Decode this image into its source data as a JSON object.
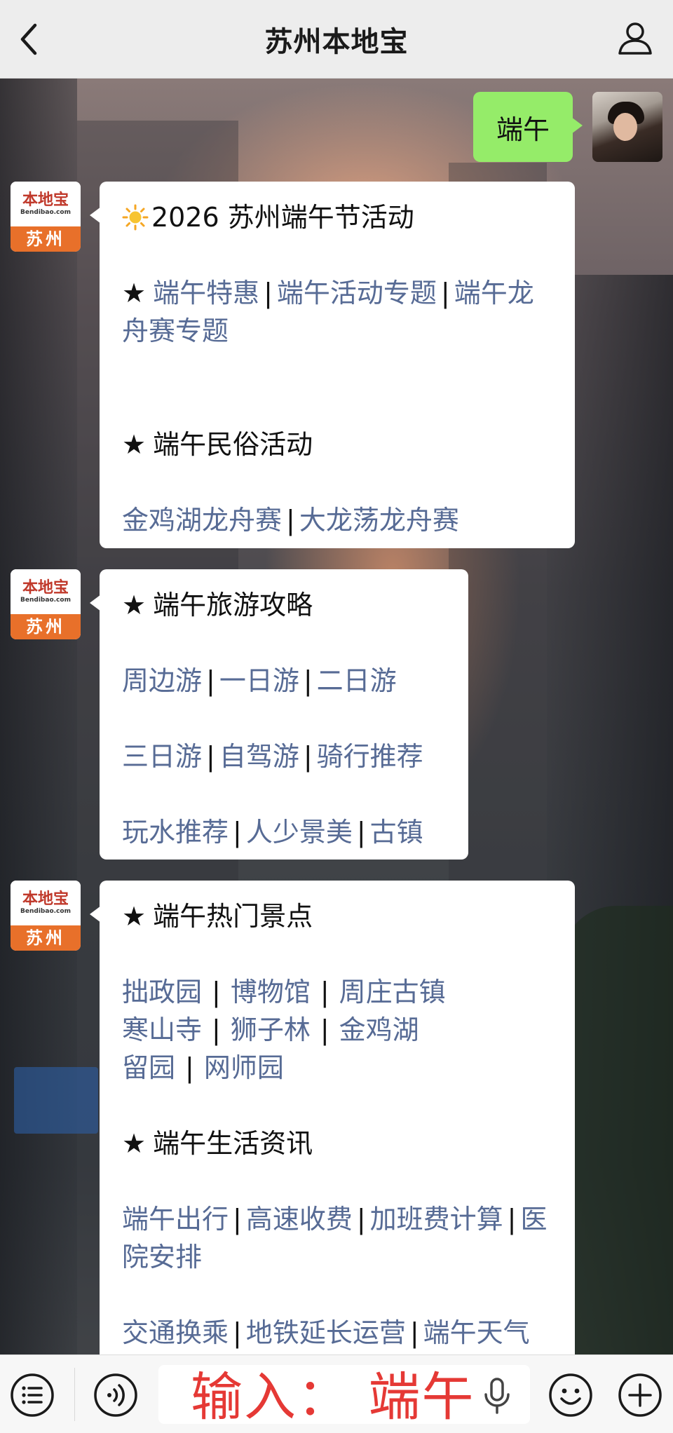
{
  "header": {
    "title": "苏州本地宝"
  },
  "user_message": {
    "text": "端午"
  },
  "bot": {
    "avatar_top": "本地宝",
    "avatar_url": "Bendibao.com",
    "avatar_city": "苏州"
  },
  "msg1": {
    "title": "2026 苏州端午节活动",
    "links1": [
      "端午特惠",
      "端午活动专题",
      "端午龙舟赛专题"
    ],
    "section_folk": "端午民俗活动",
    "links2": [
      "金鸡湖龙舟赛",
      "大龙荡龙舟赛"
    ]
  },
  "msg2": {
    "section": "端午旅游攻略",
    "row1": [
      "周边游",
      "一日游",
      "二日游"
    ],
    "row2": [
      "三日游",
      "自驾游",
      "骑行推荐"
    ],
    "row3": [
      "玩水推荐",
      "人少景美",
      "古镇"
    ]
  },
  "msg3": {
    "section_spots": "端午热门景点",
    "spots_row1": [
      "拙政园",
      "博物馆",
      "周庄古镇"
    ],
    "spots_row2": [
      "寒山寺",
      "狮子林",
      "金鸡湖"
    ],
    "spots_row3": [
      "留园",
      "网师园"
    ],
    "section_life": "端午生活资讯",
    "life_row1": [
      "端午出行",
      "高速收费",
      "加班费计算",
      "医院安排"
    ],
    "life_row2": [
      "交通换乘",
      "地铁延长运营",
      "端午天气"
    ]
  },
  "input": {
    "overlay_text": "输入：   端午"
  },
  "symbols": {
    "star": "★",
    "separator": "|"
  },
  "colors": {
    "link": "#576b95",
    "user_bubble": "#95ec69",
    "header_bg": "#ededed",
    "overlay_text": "#e53935"
  },
  "icons": [
    "back-icon",
    "profile-icon",
    "menu-list-icon",
    "voice-icon",
    "mic-icon",
    "emoji-icon",
    "plus-icon",
    "sun-icon"
  ]
}
